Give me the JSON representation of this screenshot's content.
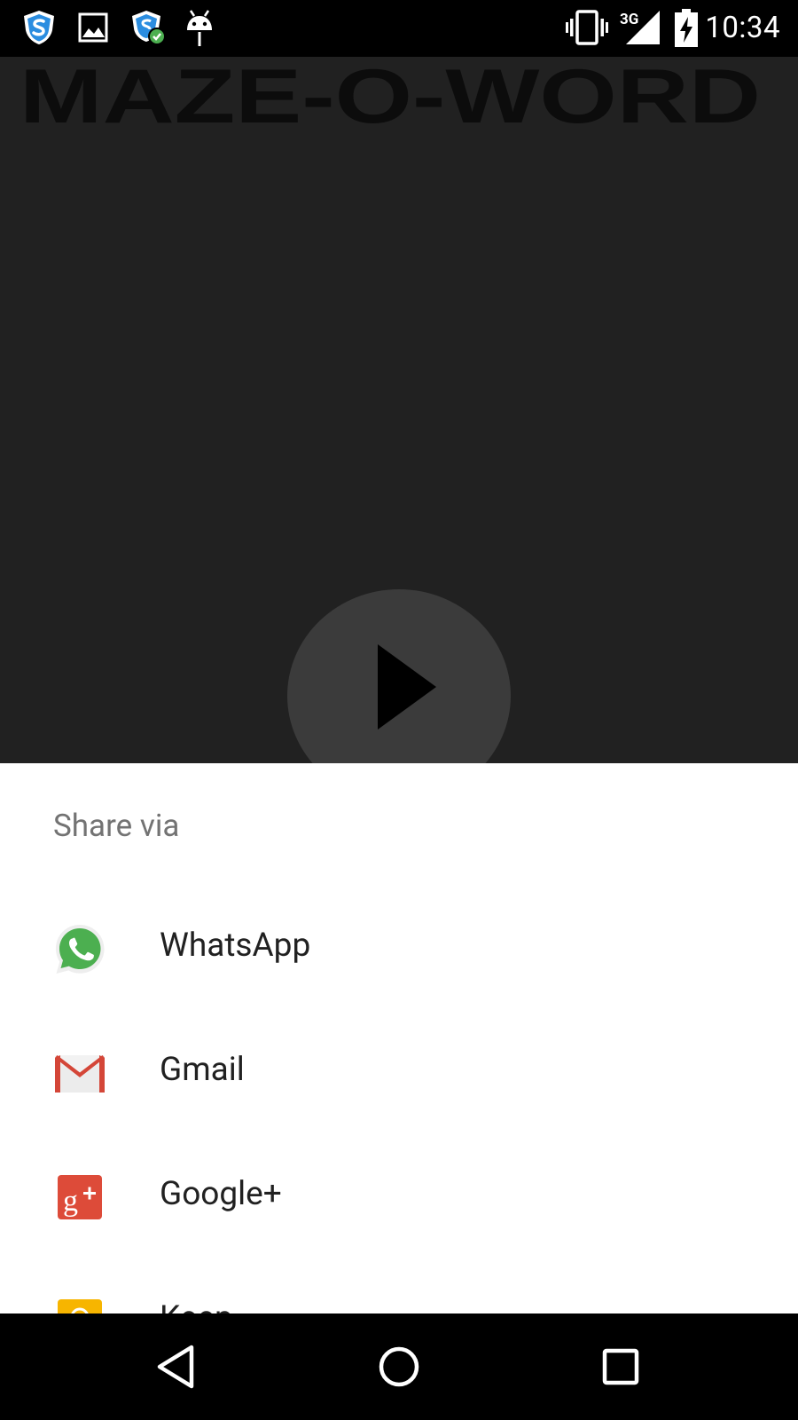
{
  "status_bar": {
    "time": "10:34",
    "network": "3G",
    "icons": [
      "shield-icon",
      "image-icon",
      "shield-check-icon",
      "android-debug-icon",
      "vibrate-icon",
      "signal-icon",
      "battery-charging-icon"
    ]
  },
  "app": {
    "title": "MAZE-O-WORD",
    "play_icon": "play-icon"
  },
  "share_sheet": {
    "title": "Share via",
    "items": [
      {
        "label": "WhatsApp",
        "icon": "whatsapp-icon"
      },
      {
        "label": "Gmail",
        "icon": "gmail-icon"
      },
      {
        "label": "Google+",
        "icon": "google-plus-icon"
      },
      {
        "label": "Keep",
        "icon": "keep-icon"
      }
    ]
  },
  "nav_bar": {
    "buttons": [
      "back-icon",
      "home-icon",
      "recents-icon"
    ]
  },
  "colors": {
    "dim_background": "#212121",
    "sheet_background": "#ffffff",
    "whatsapp_green": "#4CAF50",
    "gmail_red": "#D44638",
    "google_plus_red": "#DD4B39",
    "keep_yellow": "#F7B500"
  }
}
